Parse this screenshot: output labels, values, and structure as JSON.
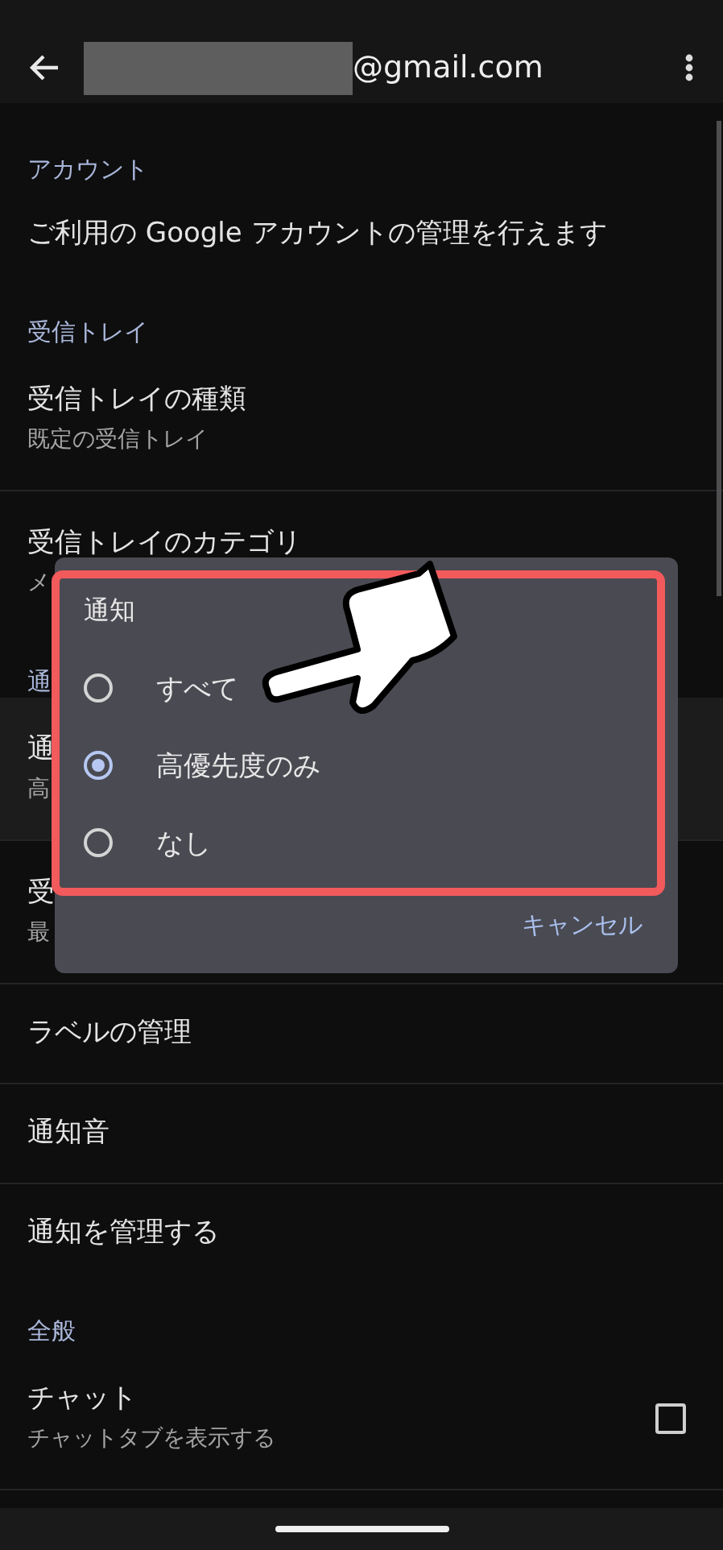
{
  "app_bar": {
    "email": "@gmail.com",
    "redacted": true
  },
  "list": [
    {
      "kind": "header",
      "title": "アカウント"
    },
    {
      "kind": "item",
      "title": "ご利用の Google アカウントの管理を行えます"
    },
    {
      "kind": "header",
      "title": "受信トレイ"
    },
    {
      "kind": "item",
      "title": "受信トレイの種類",
      "subtitle": "既定の受信トレイ"
    },
    {
      "kind": "item",
      "title": "受信トレイのカテゴリ",
      "subtitle": "メ"
    },
    {
      "kind": "header",
      "title": "通"
    },
    {
      "kind": "item",
      "title": "通",
      "subtitle": "高",
      "highlighted": true
    },
    {
      "kind": "item",
      "title": "受",
      "subtitle": "最"
    },
    {
      "kind": "item",
      "title": "ラベルの管理"
    },
    {
      "kind": "item",
      "title": "通知音"
    },
    {
      "kind": "item",
      "title": "通知を管理する"
    },
    {
      "kind": "header",
      "title": "全般"
    },
    {
      "kind": "checkbox_item",
      "title": "チャット",
      "subtitle": "チャットタブを表示する",
      "checked": false
    }
  ],
  "dialog": {
    "title": "通知",
    "options": [
      {
        "label": "すべて",
        "selected": false
      },
      {
        "label": "高優先度のみ",
        "selected": true
      },
      {
        "label": "なし",
        "selected": false
      }
    ],
    "cancel": "キャンセル"
  }
}
